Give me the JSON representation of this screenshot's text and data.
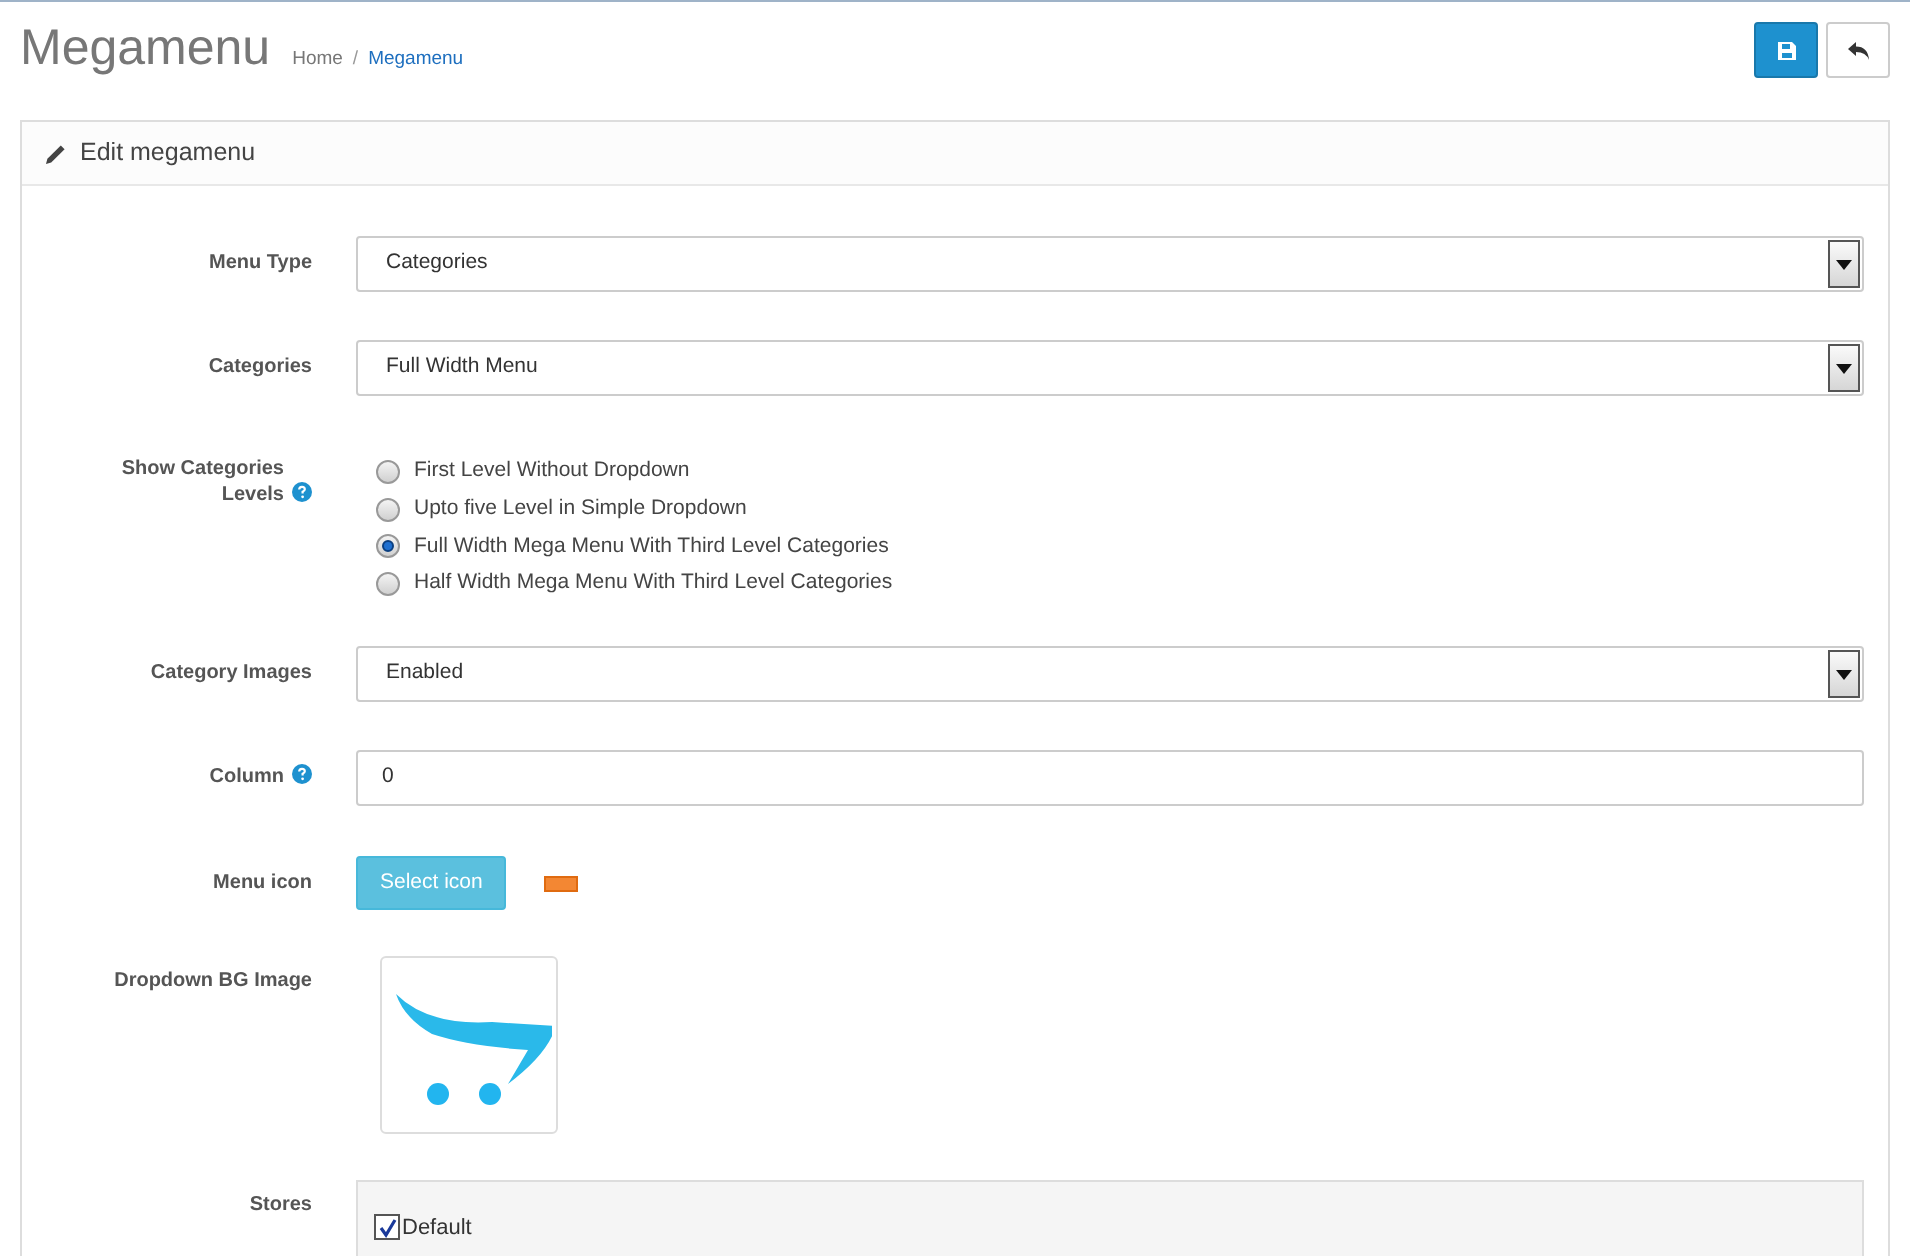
{
  "page": {
    "title": "Megamenu"
  },
  "breadcrumb": [
    {
      "label": "Home",
      "selected": false
    },
    {
      "separator": "/",
      "label": "Megamenu",
      "selected": true
    }
  ],
  "panel": {
    "title": "Edit megamenu"
  },
  "fields": [
    {
      "kind": "select",
      "label": "Menu Type",
      "value": "Categories"
    },
    {
      "kind": "select",
      "label": "Categories",
      "value": "Full Width Menu"
    },
    {
      "kind": "radio",
      "label": "Show Categories Levels",
      "help": true,
      "options": [
        {
          "label": "First Level Without Dropdown",
          "selected": false
        },
        {
          "label": "Upto five Level in Simple Dropdown",
          "selected": false
        },
        {
          "label": "Full Width Mega Menu With Third Level Categories",
          "selected": true
        },
        {
          "label": "Half Width Mega Menu With Third Level Categories",
          "selected": false
        }
      ]
    },
    {
      "kind": "select",
      "label": "Category Images",
      "value": "Enabled"
    },
    {
      "kind": "text",
      "label": "Column",
      "help": true,
      "value": "0"
    },
    {
      "kind": "icon_button",
      "label": "Menu icon",
      "button": "Select icon"
    },
    {
      "kind": "image",
      "label": "Dropdown BG Image"
    },
    {
      "kind": "checkboxes",
      "label": "Stores",
      "options": [
        {
          "label": "Default",
          "checked": true
        }
      ]
    }
  ]
}
